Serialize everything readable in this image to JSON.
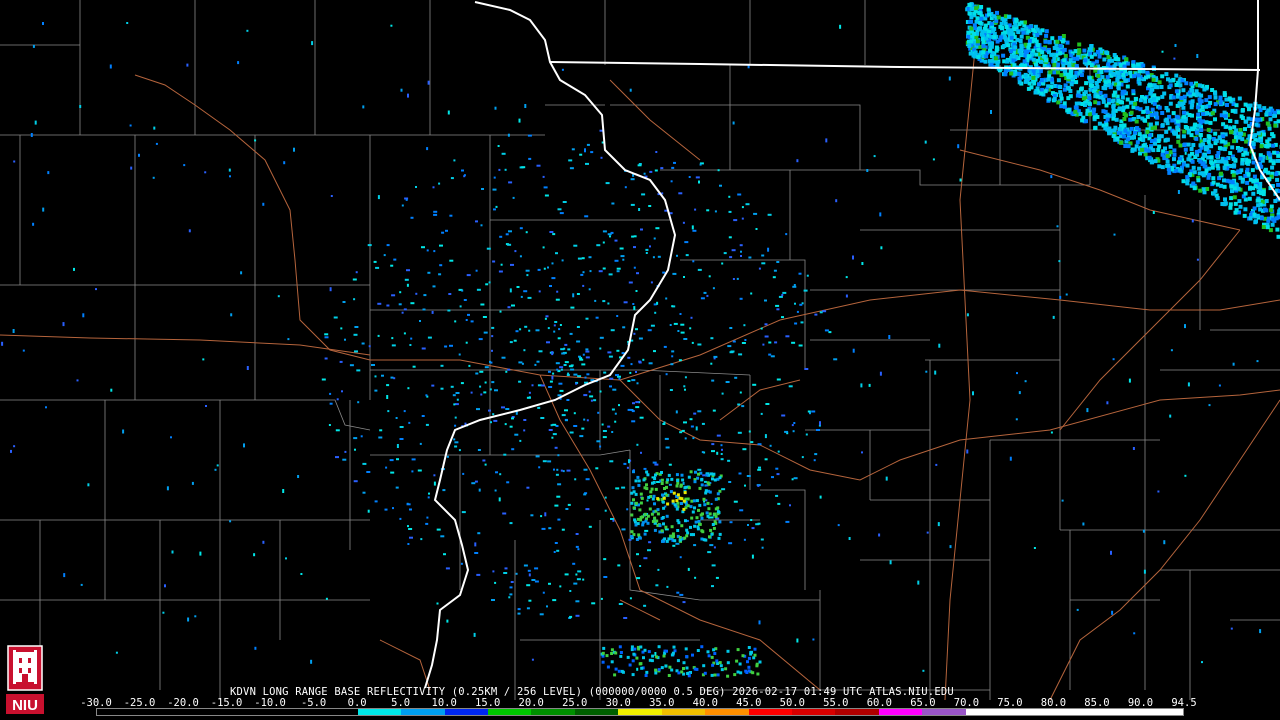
{
  "caption": "KDVN LONG RANGE BASE REFLECTIVITY (0.25KM / 256 LEVEL) (000000/0000 0.5 DEG) 2026-02-17 01:49 UTC  ATLAS.NIU.EDU",
  "logo": {
    "text": "NIU",
    "color": "#c8102e"
  },
  "colorscale": {
    "labels": [
      "-30.0",
      "-25.0",
      "-20.0",
      "-15.0",
      "-10.0",
      "-5.0",
      "0.0",
      "5.0",
      "10.0",
      "15.0",
      "20.0",
      "25.0",
      "30.0",
      "35.0",
      "40.0",
      "45.0",
      "50.0",
      "55.0",
      "60.0",
      "65.0",
      "70.0",
      "75.0",
      "80.0",
      "85.0",
      "90.0",
      "94.5"
    ],
    "colors": [
      "#000000",
      "#000000",
      "#000000",
      "#000000",
      "#000000",
      "#000000",
      "#00e8e8",
      "#00a0f0",
      "#0028f0",
      "#00c800",
      "#009000",
      "#006000",
      "#f0f000",
      "#f0c000",
      "#ff9000",
      "#ff0000",
      "#d80000",
      "#b00000",
      "#ff00ff",
      "#9955c8",
      "#ffffff",
      "#ffffff",
      "#ffffff",
      "#ffffff",
      "#ffffff"
    ]
  }
}
